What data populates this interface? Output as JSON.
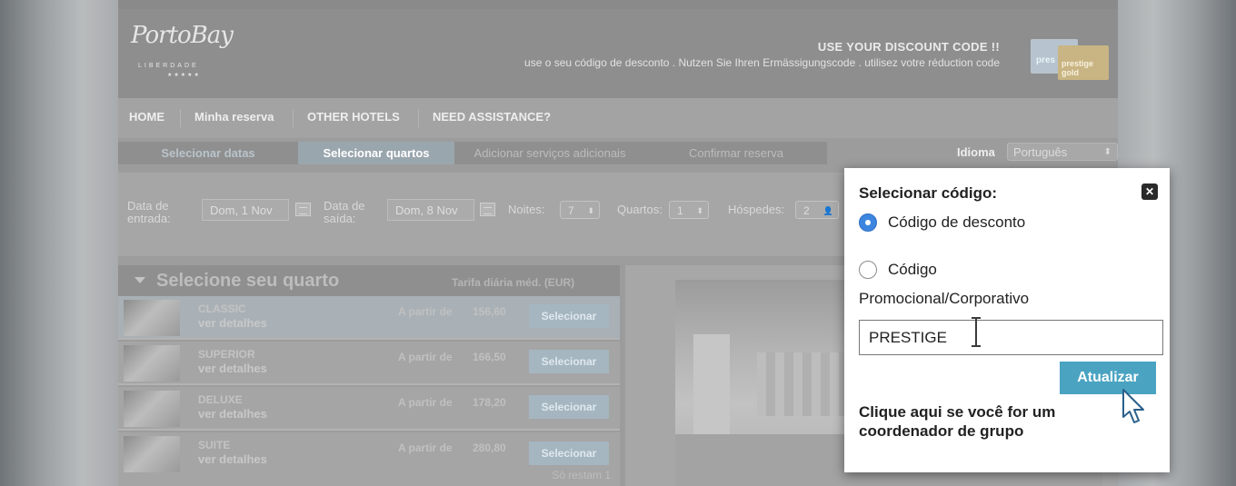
{
  "header": {
    "logo_text": "PortoBay",
    "logo_subtext": "LIBERDADE",
    "logo_stars": "★★★★★",
    "discount_title": "USE YOUR DISCOUNT CODE !!",
    "discount_subtitle": "use o seu código de desconto . Nutzen Sie Ihren Ermässigungscode . utilisez votre réduction code",
    "card_text_1": "pres",
    "card_text_2": "prestige gold"
  },
  "nav": {
    "items": [
      {
        "label": "HOME"
      },
      {
        "label": "Minha reserva"
      },
      {
        "label": "OTHER HOTELS"
      },
      {
        "label": "NEED ASSISTANCE?"
      }
    ]
  },
  "steps": [
    {
      "label": "Selecionar datas"
    },
    {
      "label": "Selecionar quartos"
    },
    {
      "label": "Adicionar serviços adicionais"
    },
    {
      "label": "Confirmar reserva"
    }
  ],
  "language": {
    "label": "Idioma",
    "selected": "Português"
  },
  "search": {
    "checkin_label": "Data de entrada:",
    "checkin_value": "Dom, 1 Nov",
    "checkout_label": "Data de saída:",
    "checkout_value": "Dom, 8 Nov",
    "nights_label": "Noites:",
    "nights_value": "7",
    "rooms_label": "Quartos:",
    "rooms_value": "1",
    "guests_label": "Hóspedes:",
    "guests_value": "2"
  },
  "rooms": {
    "title": "Selecione seu quarto",
    "rate_label": "Tarifa diária méd. (EUR)",
    "from_label": "A partir de",
    "select_label": "Selecionar",
    "details_label": "ver detalhes",
    "items": [
      {
        "name": "CLASSIC",
        "price": "156,60"
      },
      {
        "name": "SUPERIOR",
        "price": "166,50"
      },
      {
        "name": "DELUXE",
        "price": "178,20"
      },
      {
        "name": "SUITE",
        "price": "280,80",
        "note": "Só restam 1"
      }
    ]
  },
  "popup": {
    "title": "Selecionar código:",
    "close_icon": "close-icon",
    "option_discount": "Código de desconto",
    "option_promo_line1": "Código",
    "option_promo_line2": "Promocional/Corporativo",
    "selected_option": "discount",
    "code_value": "PRESTIGE",
    "update_button": "Atualizar",
    "group_link": "Clique aqui se você for um coordenador de grupo"
  },
  "colors": {
    "accent": "#49a3c1",
    "radio": "#3d86e0"
  }
}
